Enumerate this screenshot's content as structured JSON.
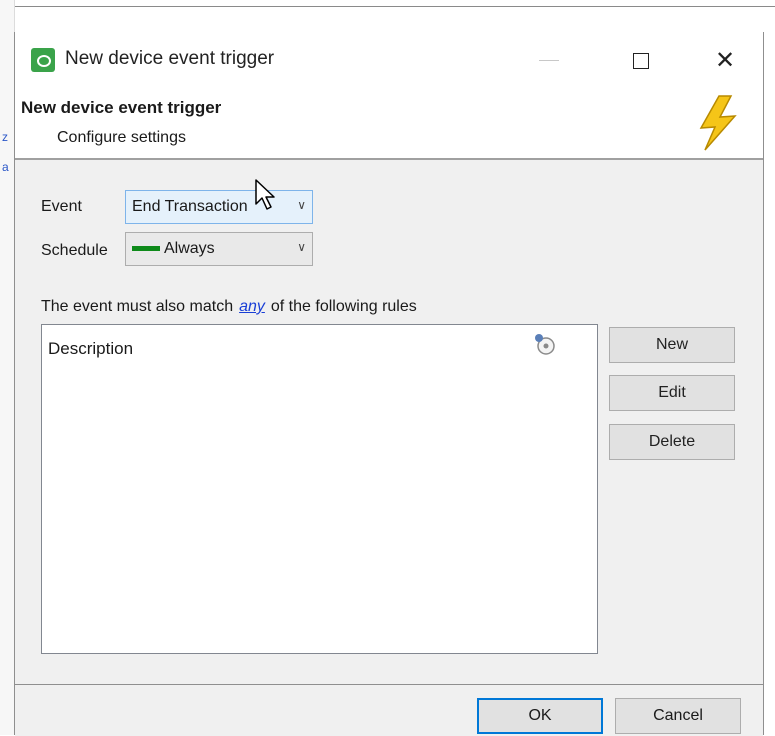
{
  "window": {
    "title": "New device event trigger",
    "icon": "app-icon"
  },
  "header": {
    "title": "New device event trigger",
    "subtitle": "Configure settings",
    "icon": "lightning-bolt-icon"
  },
  "form": {
    "event_label": "Event",
    "event_value": "End Transaction",
    "schedule_label": "Schedule",
    "schedule_value": "Always",
    "schedule_color": "#0e8a1a"
  },
  "rules": {
    "prefix": "The event must also match",
    "link": "any",
    "suffix": "of the following rules",
    "column": "Description"
  },
  "side_buttons": {
    "new": "New",
    "edit": "Edit",
    "delete": "Delete"
  },
  "footer": {
    "ok": "OK",
    "cancel": "Cancel"
  },
  "colors": {
    "link": "#1a3fd6",
    "accent": "#0078d7"
  }
}
